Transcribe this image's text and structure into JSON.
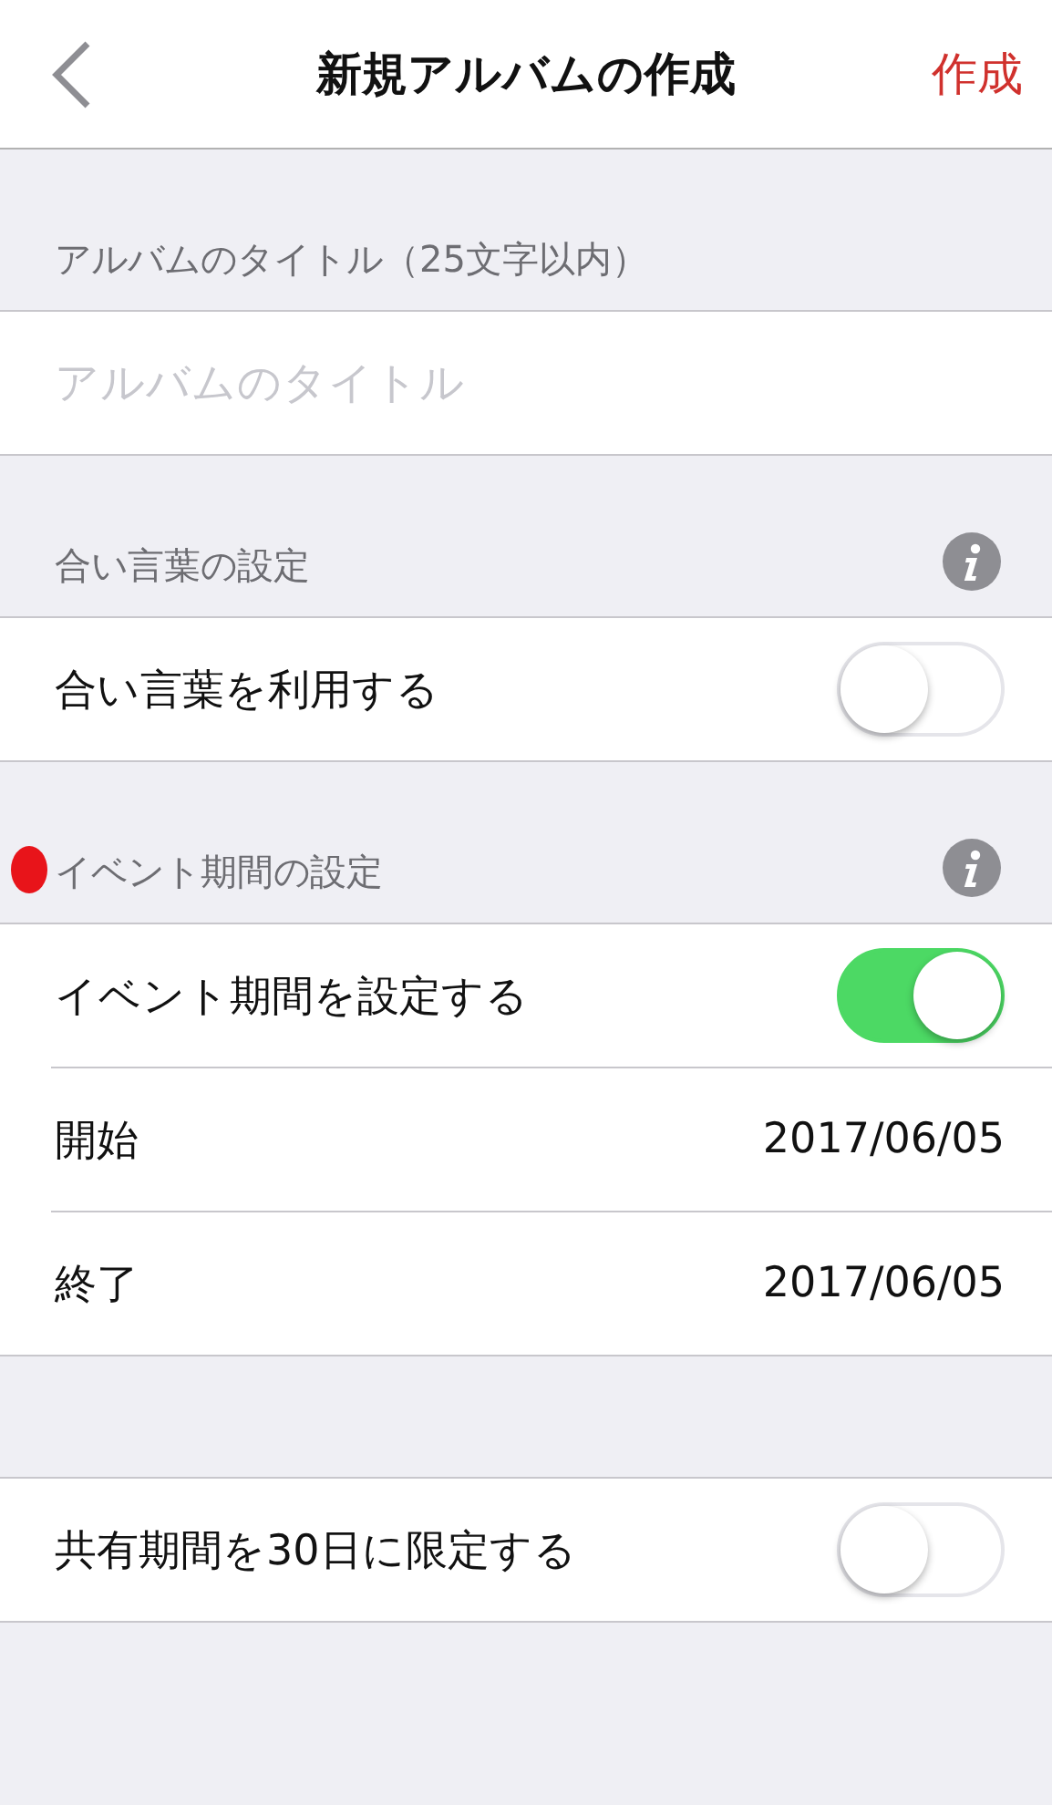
{
  "nav": {
    "title": "新規アルバムの作成",
    "action": "作成"
  },
  "sections": [
    {
      "header": "アルバムのタイトル（25文字以内）",
      "info": false,
      "marked": false,
      "rows": [
        {
          "kind": "input",
          "placeholder": "アルバムのタイトル"
        }
      ]
    },
    {
      "header": "合い言葉の設定",
      "info": true,
      "marked": false,
      "rows": [
        {
          "kind": "toggle",
          "label": "合い言葉を利用する",
          "on": false
        }
      ]
    },
    {
      "header": "イベント期間の設定",
      "info": true,
      "marked": true,
      "rows": [
        {
          "kind": "toggle",
          "label": "イベント期間を設定する",
          "on": true
        },
        {
          "kind": "value",
          "label": "開始",
          "value": "2017/06/05"
        },
        {
          "kind": "value",
          "label": "終了",
          "value": "2017/06/05"
        }
      ]
    },
    {
      "rows": [
        {
          "kind": "toggle",
          "label": "共有期間を30日に限定する",
          "on": false
        }
      ]
    }
  ]
}
